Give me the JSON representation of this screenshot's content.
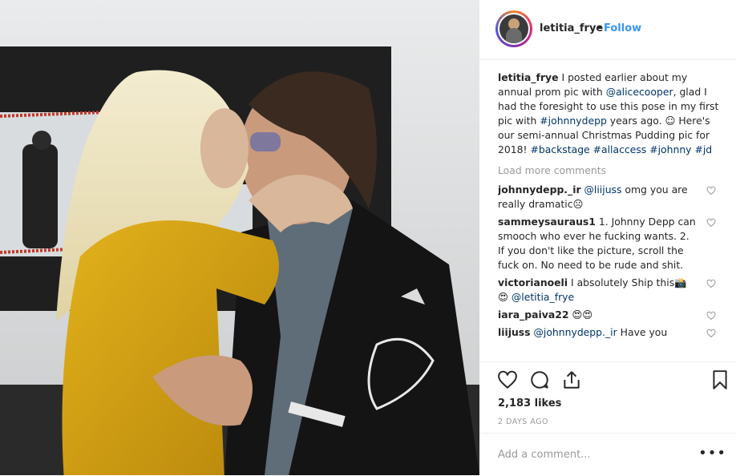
{
  "header": {
    "username": "letitia_frye",
    "separator": "•",
    "follow_label": "Follow"
  },
  "caption": {
    "username": "letitia_frye",
    "parts": [
      {
        "t": " I posted earlier about my annual prom pic with "
      },
      {
        "t": "@alicecooper",
        "link": true
      },
      {
        "t": ", glad I had the foresight to use this pose in my first pic with "
      },
      {
        "t": "#johnnydepp",
        "link": true
      },
      {
        "t": " years ago. ☺ Here's our semi-annual Christmas Pudding pic for 2018! "
      },
      {
        "t": "#backstage",
        "link": true
      },
      {
        "t": " "
      },
      {
        "t": "#allaccess",
        "link": true
      },
      {
        "t": " "
      },
      {
        "t": "#johnny",
        "link": true
      },
      {
        "t": " "
      },
      {
        "t": "#jd",
        "link": true
      }
    ]
  },
  "load_more_label": "Load more comments",
  "comments": [
    {
      "username": "johnnydepp._ir",
      "parts": [
        {
          "t": " "
        },
        {
          "t": "@liijuss",
          "link": true
        },
        {
          "t": " omg you are really dramatic☹"
        }
      ],
      "liked": false
    },
    {
      "username": "sammeysauraus1",
      "parts": [
        {
          "t": " 1. Johnny Depp can smooch who ever he fucking wants. 2. If you don't like the picture, scroll the fuck on. No need to be rude and shit."
        }
      ],
      "liked": false
    },
    {
      "username": "victorianoeli",
      "parts": [
        {
          "t": " I absolutely Ship this📸😍 "
        },
        {
          "t": "@letitia_frye",
          "link": true
        }
      ],
      "liked": false
    },
    {
      "username": "iara_paiva22",
      "parts": [
        {
          "t": " 😍😍"
        }
      ],
      "liked": false
    },
    {
      "username": "liijuss",
      "parts": [
        {
          "t": " "
        },
        {
          "t": "@johnnydepp._ir",
          "link": true
        },
        {
          "t": " Have you"
        }
      ],
      "liked": false
    }
  ],
  "actions": {
    "like_icon": "heart-icon",
    "comment_icon": "comment-bubble-icon",
    "share_icon": "share-icon",
    "save_icon": "bookmark-icon"
  },
  "likes_text": "2,183 likes",
  "timestamp": "2 DAYS AGO",
  "add_comment": {
    "placeholder": "Add a comment...",
    "more_label": "•••"
  },
  "colors": {
    "link": "#003569",
    "follow": "#3897f0",
    "muted": "#999999"
  }
}
